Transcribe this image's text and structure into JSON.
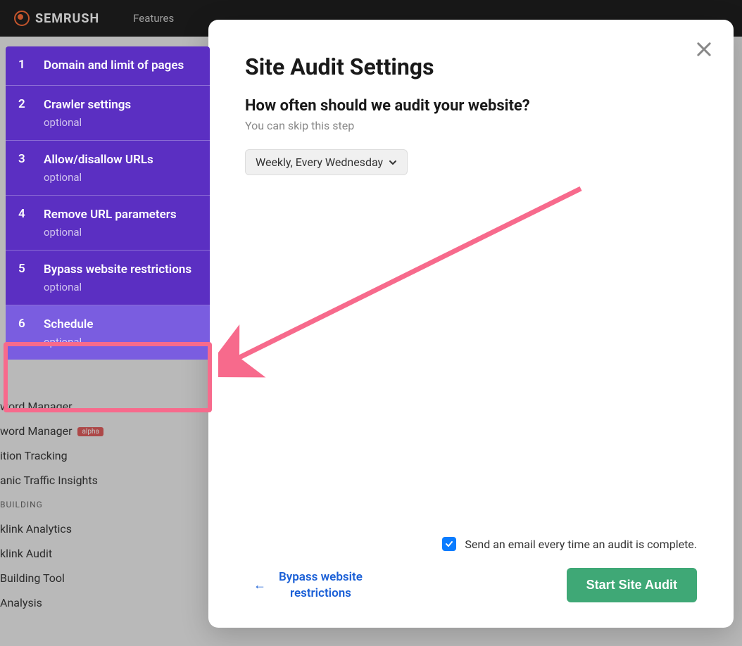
{
  "header": {
    "brand": "SEMRUSH",
    "nav_features": "Features"
  },
  "bg_menu": {
    "items_top": [
      "word Manager",
      "word Manager",
      "ition Tracking",
      "anic Traffic Insights"
    ],
    "alpha_label": "alpha",
    "section_header": " BUILDING",
    "items_bottom": [
      "klink Analytics",
      "klink Audit",
      " Building Tool",
      " Analysis"
    ]
  },
  "modal": {
    "title": "Site Audit Settings",
    "subtitle": "How often should we audit your website?",
    "hint": "You can skip this step",
    "dropdown_value": "Weekly, Every Wednesday",
    "checkbox_label": "Send an email every time an audit is complete.",
    "back_label": "Bypass website\nrestrictions",
    "start_label": "Start Site Audit"
  },
  "steps": [
    {
      "num": "1",
      "title": "Domain and limit of pages",
      "optional": ""
    },
    {
      "num": "2",
      "title": "Crawler settings",
      "optional": "optional"
    },
    {
      "num": "3",
      "title": "Allow/disallow URLs",
      "optional": "optional"
    },
    {
      "num": "4",
      "title": "Remove URL parameters",
      "optional": "optional"
    },
    {
      "num": "5",
      "title": "Bypass website restrictions",
      "optional": "optional"
    },
    {
      "num": "6",
      "title": "Schedule",
      "optional": "optional"
    }
  ],
  "colors": {
    "accent_purple": "#5b2fc2",
    "accent_purple_active": "#7a5de0",
    "annotation_pink": "#f76a8c",
    "primary_green": "#3fa876",
    "link_blue": "#1a5fd6",
    "checkbox_blue": "#0a7cff"
  }
}
